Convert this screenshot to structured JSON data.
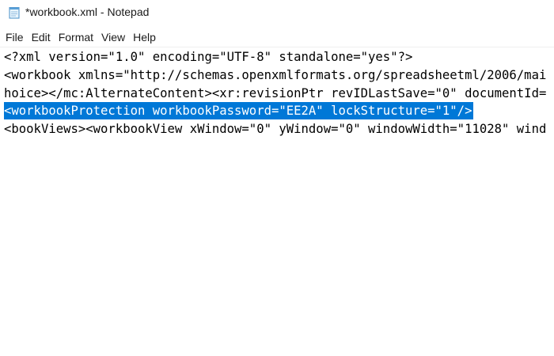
{
  "window": {
    "title": "*workbook.xml - Notepad",
    "icon": "notepad-icon"
  },
  "menu": {
    "items": [
      "File",
      "Edit",
      "Format",
      "View",
      "Help"
    ]
  },
  "editor": {
    "lines": [
      "<?xml version=\"1.0\" encoding=\"UTF-8\" standalone=\"yes\"?>",
      "<workbook xmlns=\"http://schemas.openxmlformats.org/spreadsheetml/2006/mai",
      "hoice></mc:AlternateContent><xr:revisionPtr revIDLastSave=\"0\" documentId=",
      "<workbookProtection workbookPassword=\"EE2A\" lockStructure=\"1\"/>",
      "<bookViews><workbookView xWindow=\"0\" yWindow=\"0\" windowWidth=\"11028\" wind"
    ],
    "selected_line_index": 3
  },
  "colors": {
    "selection": "#0078d7",
    "text": "#000000",
    "background": "#ffffff"
  }
}
